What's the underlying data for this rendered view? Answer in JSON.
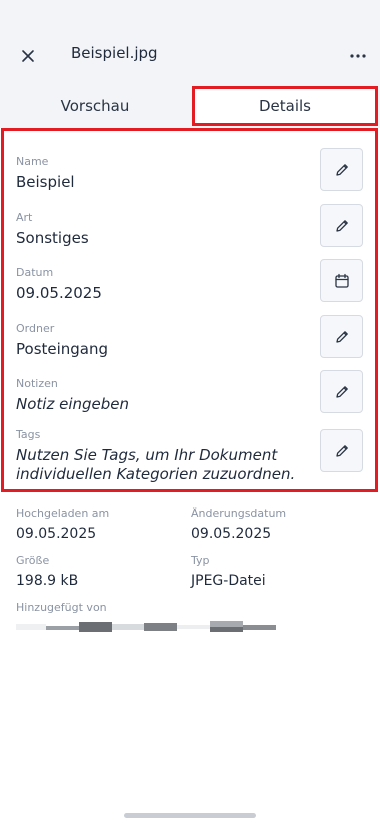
{
  "header": {
    "title": "Beispiel.jpg",
    "close_icon": "close-icon",
    "more_icon": "more-horizontal-icon"
  },
  "tabs": [
    {
      "label": "Vorschau",
      "active": false
    },
    {
      "label": "Details",
      "active": true
    }
  ],
  "fields": {
    "name": {
      "label": "Name",
      "value": "Beispiel",
      "action_icon": "pencil-icon"
    },
    "type": {
      "label": "Art",
      "value": "Sonstiges",
      "action_icon": "pencil-icon"
    },
    "date": {
      "label": "Datum",
      "value": "09.05.2025",
      "action_icon": "calendar-icon"
    },
    "folder": {
      "label": "Ordner",
      "value": "Posteingang",
      "action_icon": "pencil-icon"
    },
    "notes": {
      "label": "Notizen",
      "placeholder": "Notiz eingeben",
      "action_icon": "pencil-icon"
    },
    "tags": {
      "label": "Tags",
      "placeholder": "Nutzen Sie Tags, um Ihr Dokument individuellen Kategorien zuzuordnen.",
      "action_icon": "pencil-icon"
    }
  },
  "meta": {
    "uploaded": {
      "label": "Hochgeladen am",
      "value": "09.05.2025"
    },
    "modified": {
      "label": "Änderungsdatum",
      "value": "09.05.2025"
    },
    "size": {
      "label": "Größe",
      "value": "198.9 kB"
    },
    "filetype": {
      "label": "Typ",
      "value": "JPEG-Datei"
    },
    "added_by": {
      "label": "Hinzugefügt von"
    }
  },
  "colors": {
    "highlight": "#e31b23",
    "header_bg": "#f2f4f7",
    "text": "#1f2a3c",
    "label": "#8a93a3"
  }
}
